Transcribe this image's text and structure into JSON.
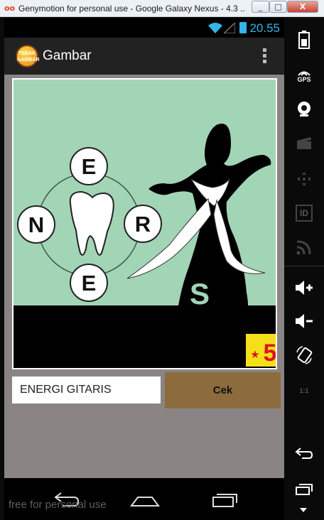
{
  "window": {
    "logo": "oo",
    "title": "Genymotion for personal use - Google Galaxy Nexus - 4.3 ...",
    "min": "_",
    "max": "□",
    "close": "X"
  },
  "statusbar": {
    "time": "20.55"
  },
  "actionbar": {
    "title": "Gambar",
    "logo_text": "TEBAK GAMBAR"
  },
  "puzzle": {
    "letters": [
      "E",
      "N",
      "R",
      "E"
    ],
    "letter_s": "S",
    "level_badge": "5"
  },
  "answer": {
    "value": "ENERGI GITARIS"
  },
  "buttons": {
    "cek": "Cek"
  },
  "watermark": "free for personal use",
  "sidebar": {
    "items": [
      {
        "icon": "battery-icon",
        "label": ""
      },
      {
        "icon": "gps-icon",
        "label": "GPS"
      },
      {
        "icon": "webcam-icon",
        "label": ""
      },
      {
        "icon": "video-capture-icon",
        "label": ""
      },
      {
        "icon": "remote-control-icon",
        "label": ""
      },
      {
        "icon": "id-icon",
        "label": "ID"
      },
      {
        "icon": "cast-icon",
        "label": ""
      },
      {
        "icon": "volume-up-icon",
        "label": ""
      },
      {
        "icon": "volume-down-icon",
        "label": ""
      },
      {
        "icon": "rotate-icon",
        "label": ""
      },
      {
        "icon": "pixel-perfect-icon",
        "label": "1:1"
      },
      {
        "icon": "back-icon",
        "label": ""
      },
      {
        "icon": "recent-apps-icon",
        "label": ""
      }
    ]
  },
  "colors": {
    "puzzle_bg": "#a2d4b6",
    "cek_button": "#8c6c3c",
    "status_accent": "#31b6e7",
    "level_badge_bg": "#f5df19",
    "level_badge_fg": "#e0121e"
  }
}
